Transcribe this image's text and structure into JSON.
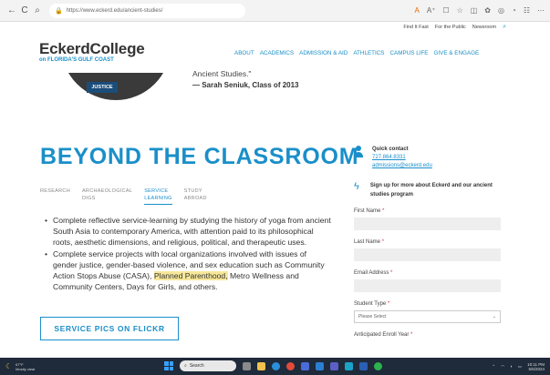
{
  "browser": {
    "url": "https://www.eckerd.edu/ancient-studies/",
    "nav_icons": [
      "←",
      "C",
      "⌕"
    ],
    "ext_icons": [
      "A",
      "A⁺",
      "☐",
      "☆",
      "◫",
      "✿",
      "◎",
      "◔",
      "☷",
      "⋯"
    ]
  },
  "util_nav": [
    "Find It Fast",
    "For the Public",
    "Newsroom"
  ],
  "logo": {
    "main": "EckerdCollege",
    "sub": "on FLORIDA'S GULF COAST"
  },
  "main_nav": [
    "ABOUT",
    "ACADEMICS",
    "ADMISSION & AID",
    "ATHLETICS",
    "CAMPUS LIFE",
    "GIVE & ENGAGE"
  ],
  "hero": {
    "badge": "JUSTICE",
    "quote_tail": "Ancient Studies.\"",
    "author": "— Sarah Seniuk, Class of 2013"
  },
  "section": {
    "title": "BEYOND THE CLASSROOM",
    "tabs": [
      {
        "line1": "RESEARCH",
        "line2": ""
      },
      {
        "line1": "ARCHAEOLOGICAL",
        "line2": "DIGS"
      },
      {
        "line1": "SERVICE",
        "line2": "LEARNING"
      },
      {
        "line1": "STUDY",
        "line2": "ABROAD"
      }
    ],
    "bullet1": "Complete reflective service-learning by studying the history of yoga from ancient South Asia to contemporary America, with attention paid to its philosophical roots, aesthetic dimensions, and religious, political, and therapeutic uses.",
    "bullet2_pre": "Complete service projects with local organizations involved with issues of gender justice, gender-based violence, and sex education such as Community Action Stops Abuse (CASA), ",
    "bullet2_highlight": "Planned Parenthood,",
    "bullet2_post": " Metro Wellness and Community Centers, Days for Girls, and others.",
    "button": "SERVICE PICS ON FLICKR"
  },
  "sidebar": {
    "contact_title": "Quick contact",
    "phone": "727.864.8331",
    "email": "admissions@eckerd.edu",
    "signup": "Sign up for more about Eckerd and our ancient studies program",
    "fields": {
      "first_name": "First Name",
      "last_name": "Last Name",
      "email": "Email Address",
      "student_type": "Student Type",
      "student_type_value": "Please Select",
      "enroll_year": "Anticipated Enroll Year"
    },
    "required_mark": "*"
  },
  "taskbar": {
    "weather_temp": "67°F",
    "weather_desc": "Mostly clear",
    "search": "Search",
    "time": "10:11 PM",
    "date": "5/6/2024"
  },
  "colors": {
    "accent": "#1a8fc9",
    "highlight": "#f7e79a",
    "taskbar": "#1f2a3a"
  }
}
